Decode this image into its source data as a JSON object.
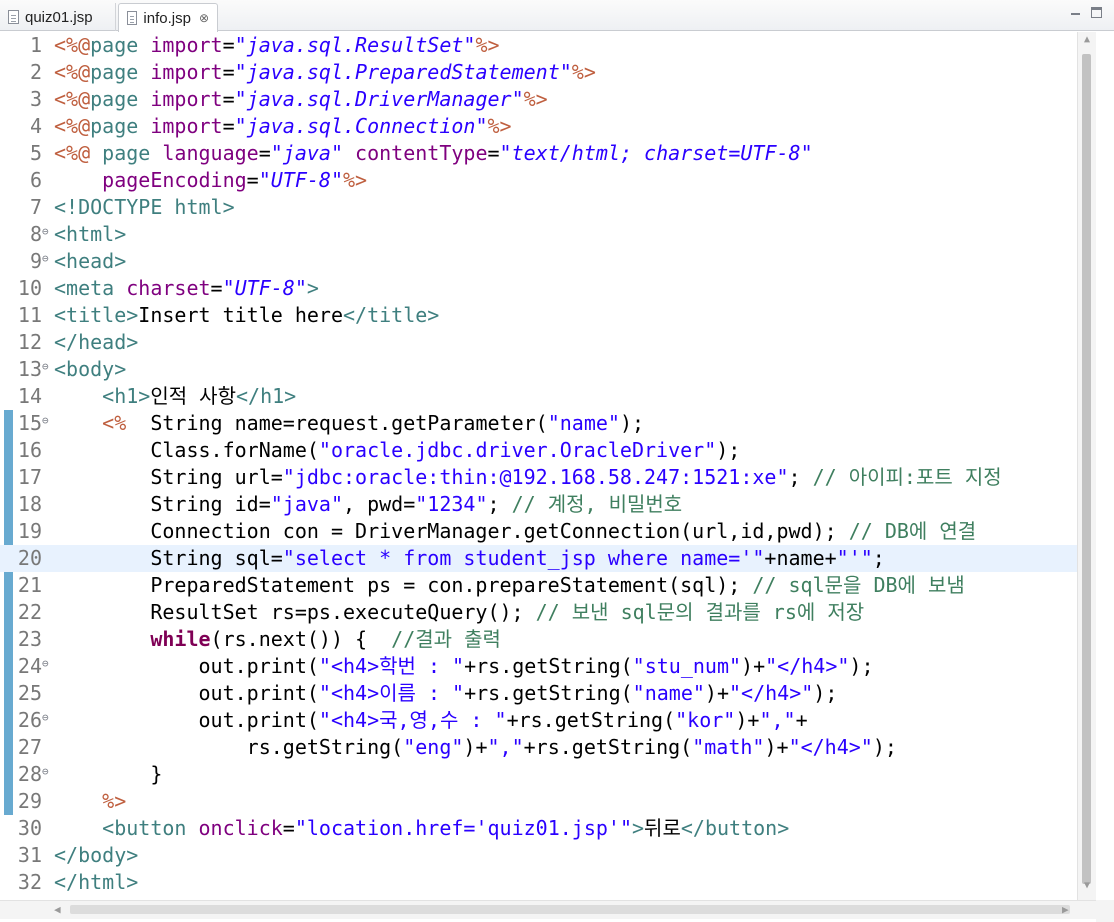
{
  "tabs": [
    {
      "label": "quiz01.jsp",
      "active": false
    },
    {
      "label": "info.jsp",
      "active": true,
      "close": "⊗"
    }
  ],
  "colors": {
    "tag": "#3f7f7f",
    "directive": "#bf5f3f",
    "attribute": "#7f007f",
    "value": "#2a00ff",
    "keyword": "#7f0055",
    "comment": "#3f7f5f",
    "current_line": "#e8f2fe",
    "change_bar": "#4d9bc8"
  },
  "editor": {
    "current_line": 20,
    "fold_markers": [
      8,
      9,
      13,
      15,
      24,
      26,
      28
    ],
    "lines": [
      {
        "n": "1",
        "tokens": [
          [
            "dir",
            "<%@"
          ],
          [
            "tag",
            "page "
          ],
          [
            "attr",
            "import"
          ],
          [
            "txt",
            "="
          ],
          [
            "val",
            "\"java.sql.ResultSet\""
          ],
          [
            "dir",
            "%>"
          ]
        ]
      },
      {
        "n": "2",
        "tokens": [
          [
            "dir",
            "<%@"
          ],
          [
            "tag",
            "page "
          ],
          [
            "attr",
            "import"
          ],
          [
            "txt",
            "="
          ],
          [
            "val",
            "\"java.sql.PreparedStatement\""
          ],
          [
            "dir",
            "%>"
          ]
        ]
      },
      {
        "n": "3",
        "tokens": [
          [
            "dir",
            "<%@"
          ],
          [
            "tag",
            "page "
          ],
          [
            "attr",
            "import"
          ],
          [
            "txt",
            "="
          ],
          [
            "val",
            "\"java.sql.DriverManager\""
          ],
          [
            "dir",
            "%>"
          ]
        ]
      },
      {
        "n": "4",
        "tokens": [
          [
            "dir",
            "<%@"
          ],
          [
            "tag",
            "page "
          ],
          [
            "attr",
            "import"
          ],
          [
            "txt",
            "="
          ],
          [
            "val",
            "\"java.sql.Connection\""
          ],
          [
            "dir",
            "%>"
          ]
        ]
      },
      {
        "n": "5",
        "tokens": [
          [
            "dir",
            "<%@"
          ],
          [
            "tag",
            " page "
          ],
          [
            "attr",
            "language"
          ],
          [
            "txt",
            "="
          ],
          [
            "val",
            "\"java\""
          ],
          [
            "txt",
            " "
          ],
          [
            "attr",
            "contentType"
          ],
          [
            "txt",
            "="
          ],
          [
            "val",
            "\"text/html; charset=UTF-8\""
          ]
        ]
      },
      {
        "n": "6",
        "tokens": [
          [
            "txt",
            "    "
          ],
          [
            "attr",
            "pageEncoding"
          ],
          [
            "txt",
            "="
          ],
          [
            "val",
            "\"UTF-8\""
          ],
          [
            "dir",
            "%>"
          ]
        ]
      },
      {
        "n": "7",
        "tokens": [
          [
            "tag",
            "<!DOCTYPE html>"
          ]
        ]
      },
      {
        "n": "8",
        "tokens": [
          [
            "tag",
            "<html>"
          ]
        ]
      },
      {
        "n": "9",
        "tokens": [
          [
            "tag",
            "<head>"
          ]
        ]
      },
      {
        "n": "10",
        "tokens": [
          [
            "tag",
            "<meta "
          ],
          [
            "attr",
            "charset"
          ],
          [
            "txt",
            "="
          ],
          [
            "val",
            "\"UTF-8\""
          ],
          [
            "tag",
            ">"
          ]
        ]
      },
      {
        "n": "11",
        "tokens": [
          [
            "tag",
            "<title>"
          ],
          [
            "txt",
            "Insert title here"
          ],
          [
            "tag",
            "</title>"
          ]
        ]
      },
      {
        "n": "12",
        "tokens": [
          [
            "tag",
            "</head>"
          ]
        ]
      },
      {
        "n": "13",
        "tokens": [
          [
            "tag",
            "<body>"
          ]
        ]
      },
      {
        "n": "14",
        "tokens": [
          [
            "txt",
            "    "
          ],
          [
            "tag",
            "<h1>"
          ],
          [
            "txt",
            "인적 사항"
          ],
          [
            "tag",
            "</h1>"
          ]
        ]
      },
      {
        "n": "15",
        "tokens": [
          [
            "txt",
            "    "
          ],
          [
            "dir",
            "<%"
          ],
          [
            "txt",
            "  String name=request.getParameter("
          ],
          [
            "str",
            "\"name\""
          ],
          [
            "txt",
            ");"
          ]
        ]
      },
      {
        "n": "16",
        "tokens": [
          [
            "txt",
            "        Class.forName("
          ],
          [
            "str",
            "\"oracle.jdbc.driver.OracleDriver\""
          ],
          [
            "txt",
            ");"
          ]
        ]
      },
      {
        "n": "17",
        "tokens": [
          [
            "txt",
            "        String url="
          ],
          [
            "str",
            "\"jdbc:oracle:thin:@192.168.58.247:1521:xe\""
          ],
          [
            "txt",
            "; "
          ],
          [
            "cmt",
            "// 아이피:포트 지정"
          ]
        ]
      },
      {
        "n": "18",
        "tokens": [
          [
            "txt",
            "        String id="
          ],
          [
            "str",
            "\"java\""
          ],
          [
            "txt",
            ", pwd="
          ],
          [
            "str",
            "\"1234\""
          ],
          [
            "txt",
            "; "
          ],
          [
            "cmt",
            "// 계정, 비밀번호"
          ]
        ]
      },
      {
        "n": "19",
        "tokens": [
          [
            "txt",
            "        Connection con = DriverManager.getConnection(url,id,pwd); "
          ],
          [
            "cmt",
            "// DB에 연결"
          ]
        ]
      },
      {
        "n": "20",
        "tokens": [
          [
            "txt",
            "        String sql="
          ],
          [
            "str",
            "\"select * from student_jsp where name='\""
          ],
          [
            "txt",
            "+name+"
          ],
          [
            "str",
            "\"'\""
          ],
          [
            "txt",
            ";"
          ]
        ]
      },
      {
        "n": "21",
        "tokens": [
          [
            "txt",
            "        PreparedStatement ps = con.prepareStatement(sql); "
          ],
          [
            "cmt",
            "// sql문을 DB에 보냄"
          ]
        ]
      },
      {
        "n": "22",
        "tokens": [
          [
            "txt",
            "        ResultSet rs=ps.executeQuery(); "
          ],
          [
            "cmt",
            "// 보낸 sql문의 결과를 rs에 저장"
          ]
        ]
      },
      {
        "n": "23",
        "tokens": [
          [
            "txt",
            "        "
          ],
          [
            "kw",
            "while"
          ],
          [
            "txt",
            "(rs.next()) {  "
          ],
          [
            "cmt",
            "//결과 출력"
          ]
        ]
      },
      {
        "n": "24",
        "tokens": [
          [
            "txt",
            "            out.print("
          ],
          [
            "str",
            "\"<h4>학번 : \""
          ],
          [
            "txt",
            "+rs.getString("
          ],
          [
            "str",
            "\"stu_num\""
          ],
          [
            "txt",
            ")+"
          ],
          [
            "str",
            "\"</h4>\""
          ],
          [
            "txt",
            ");"
          ]
        ]
      },
      {
        "n": "25",
        "tokens": [
          [
            "txt",
            "            out.print("
          ],
          [
            "str",
            "\"<h4>이름 : \""
          ],
          [
            "txt",
            "+rs.getString("
          ],
          [
            "str",
            "\"name\""
          ],
          [
            "txt",
            ")+"
          ],
          [
            "str",
            "\"</h4>\""
          ],
          [
            "txt",
            ");"
          ]
        ]
      },
      {
        "n": "26",
        "tokens": [
          [
            "txt",
            "            out.print("
          ],
          [
            "str",
            "\"<h4>국,영,수 : \""
          ],
          [
            "txt",
            "+rs.getString("
          ],
          [
            "str",
            "\"kor\""
          ],
          [
            "txt",
            ")+"
          ],
          [
            "str",
            "\",\""
          ],
          [
            "txt",
            "+"
          ]
        ]
      },
      {
        "n": "27",
        "tokens": [
          [
            "txt",
            "                rs.getString("
          ],
          [
            "str",
            "\"eng\""
          ],
          [
            "txt",
            ")+"
          ],
          [
            "str",
            "\",\""
          ],
          [
            "txt",
            "+rs.getString("
          ],
          [
            "str",
            "\"math\""
          ],
          [
            "txt",
            ")+"
          ],
          [
            "str",
            "\"</h4>\""
          ],
          [
            "txt",
            ");"
          ]
        ]
      },
      {
        "n": "28",
        "tokens": [
          [
            "txt",
            "        }"
          ]
        ]
      },
      {
        "n": "29",
        "tokens": [
          [
            "txt",
            "    "
          ],
          [
            "dir",
            "%>"
          ]
        ]
      },
      {
        "n": "30",
        "tokens": [
          [
            "txt",
            "    "
          ],
          [
            "tag",
            "<button "
          ],
          [
            "attr",
            "onclick"
          ],
          [
            "txt",
            "="
          ],
          [
            "str",
            "\"location.href='quiz01.jsp'\""
          ],
          [
            "tag",
            ">"
          ],
          [
            "txt",
            "뒤로"
          ],
          [
            "tag",
            "</button>"
          ]
        ]
      },
      {
        "n": "31",
        "tokens": [
          [
            "tag",
            "</body>"
          ]
        ]
      },
      {
        "n": "32",
        "tokens": [
          [
            "tag",
            "</html>"
          ]
        ]
      }
    ]
  },
  "scroll": {
    "up": "▲",
    "down": "▼",
    "left": "◀",
    "right": "▶"
  }
}
